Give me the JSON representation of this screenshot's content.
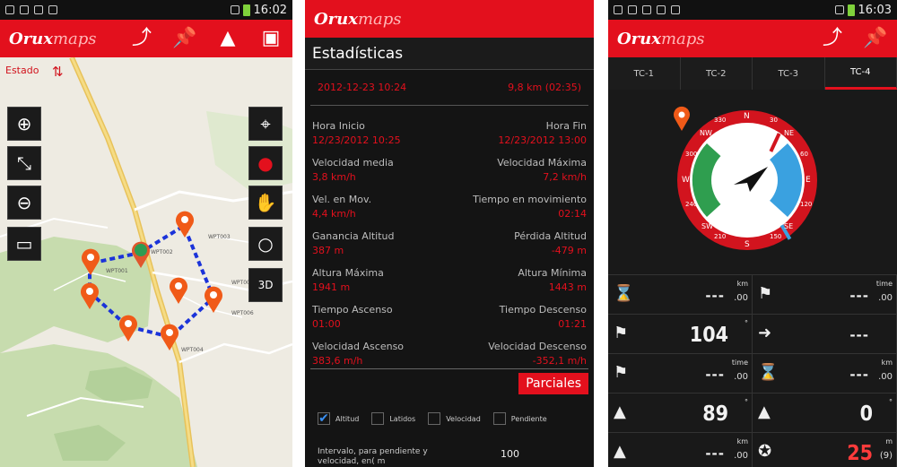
{
  "status_bar": {
    "time_left": "16:02",
    "time_right": "16:03"
  },
  "app": {
    "logo_prefix": "Orux",
    "logo_suffix": "maps"
  },
  "map_screen": {
    "estado_label": "Estado",
    "waypoint_labels": [
      "WPT003",
      "WPT001",
      "WPT002",
      "WPT006",
      "WPT004",
      "WPT005"
    ],
    "accent": "#e3101d"
  },
  "stats_screen": {
    "title": "Estadísticas",
    "summary_date": "2012-12-23 10:24",
    "summary_distance": "9,8 km (02:35)",
    "rows": [
      {
        "left_label": "Hora Inicio",
        "right_label": "Hora Fin",
        "left_value": "12/23/2012 10:25",
        "right_value": "12/23/2012 13:00"
      },
      {
        "left_label": "Velocidad media",
        "right_label": "Velocidad Máxima",
        "left_value": "3,8 km/h",
        "right_value": "7,2 km/h"
      },
      {
        "left_label": "Vel. en Mov.",
        "right_label": "Tiempo en movimiento",
        "left_value": "4,4 km/h",
        "right_value": "02:14"
      },
      {
        "left_label": "Ganancia Altitud",
        "right_label": "Pérdida Altitud",
        "left_value": "387 m",
        "right_value": "-479 m"
      },
      {
        "left_label": "Altura Máxima",
        "right_label": "Altura Mínima",
        "left_value": "1941 m",
        "right_value": "1443 m"
      },
      {
        "left_label": "Tiempo Ascenso",
        "right_label": "Tiempo Descenso",
        "left_value": "01:00",
        "right_value": "01:21"
      },
      {
        "left_label": "Velocidad Ascenso",
        "right_label": "Velocidad Descenso",
        "left_value": "383,6 m/h",
        "right_value": "-352,1 m/h"
      }
    ],
    "parciales_button": "Parciales",
    "checkboxes": [
      {
        "label": "Altitud",
        "checked": true
      },
      {
        "label": "Latidos",
        "checked": false
      },
      {
        "label": "Velocidad",
        "checked": false
      },
      {
        "label": "Pendiente",
        "checked": false
      }
    ],
    "interval_label": "Intervalo, para pendiente y velocidad, en( m",
    "interval_value": "100"
  },
  "dashboard_screen": {
    "tabs": [
      "TC-1",
      "TC-2",
      "TC-3",
      "TC-4"
    ],
    "active_tab": 3,
    "compass": {
      "cardinals": [
        "N",
        "NE",
        "E",
        "SE",
        "S",
        "SW",
        "W",
        "NW"
      ],
      "ticks": [
        "30",
        "60",
        "120",
        "150",
        "210",
        "240",
        "300",
        "330"
      ]
    },
    "cells": [
      {
        "icon": "hourglass-icon",
        "value": "---",
        "unit": "km",
        "sub": ".00"
      },
      {
        "icon": "checkered-flag-icon",
        "value": "---",
        "unit": "time",
        "sub": ".00"
      },
      {
        "icon": "checkered-flag-icon",
        "value": "104",
        "unit": "°",
        "sub": ""
      },
      {
        "icon": "arrow-right-icon",
        "value": "---",
        "unit": "",
        "sub": ""
      },
      {
        "icon": "checkered-flag-icon",
        "value": "---",
        "unit": "time",
        "sub": ".00"
      },
      {
        "icon": "hourglass-icon",
        "value": "---",
        "unit": "km",
        "sub": ".00"
      },
      {
        "icon": "altitude-icon",
        "value": "89",
        "unit": "°",
        "sub": ""
      },
      {
        "icon": "altitude-icon",
        "value": "0",
        "unit": "°",
        "sub": ""
      },
      {
        "icon": "altitude-icon",
        "value": "---",
        "unit": "km",
        "sub": ".00"
      },
      {
        "icon": "compass-rose-icon",
        "value": "25",
        "unit": "m",
        "sub": "(9)"
      }
    ]
  }
}
